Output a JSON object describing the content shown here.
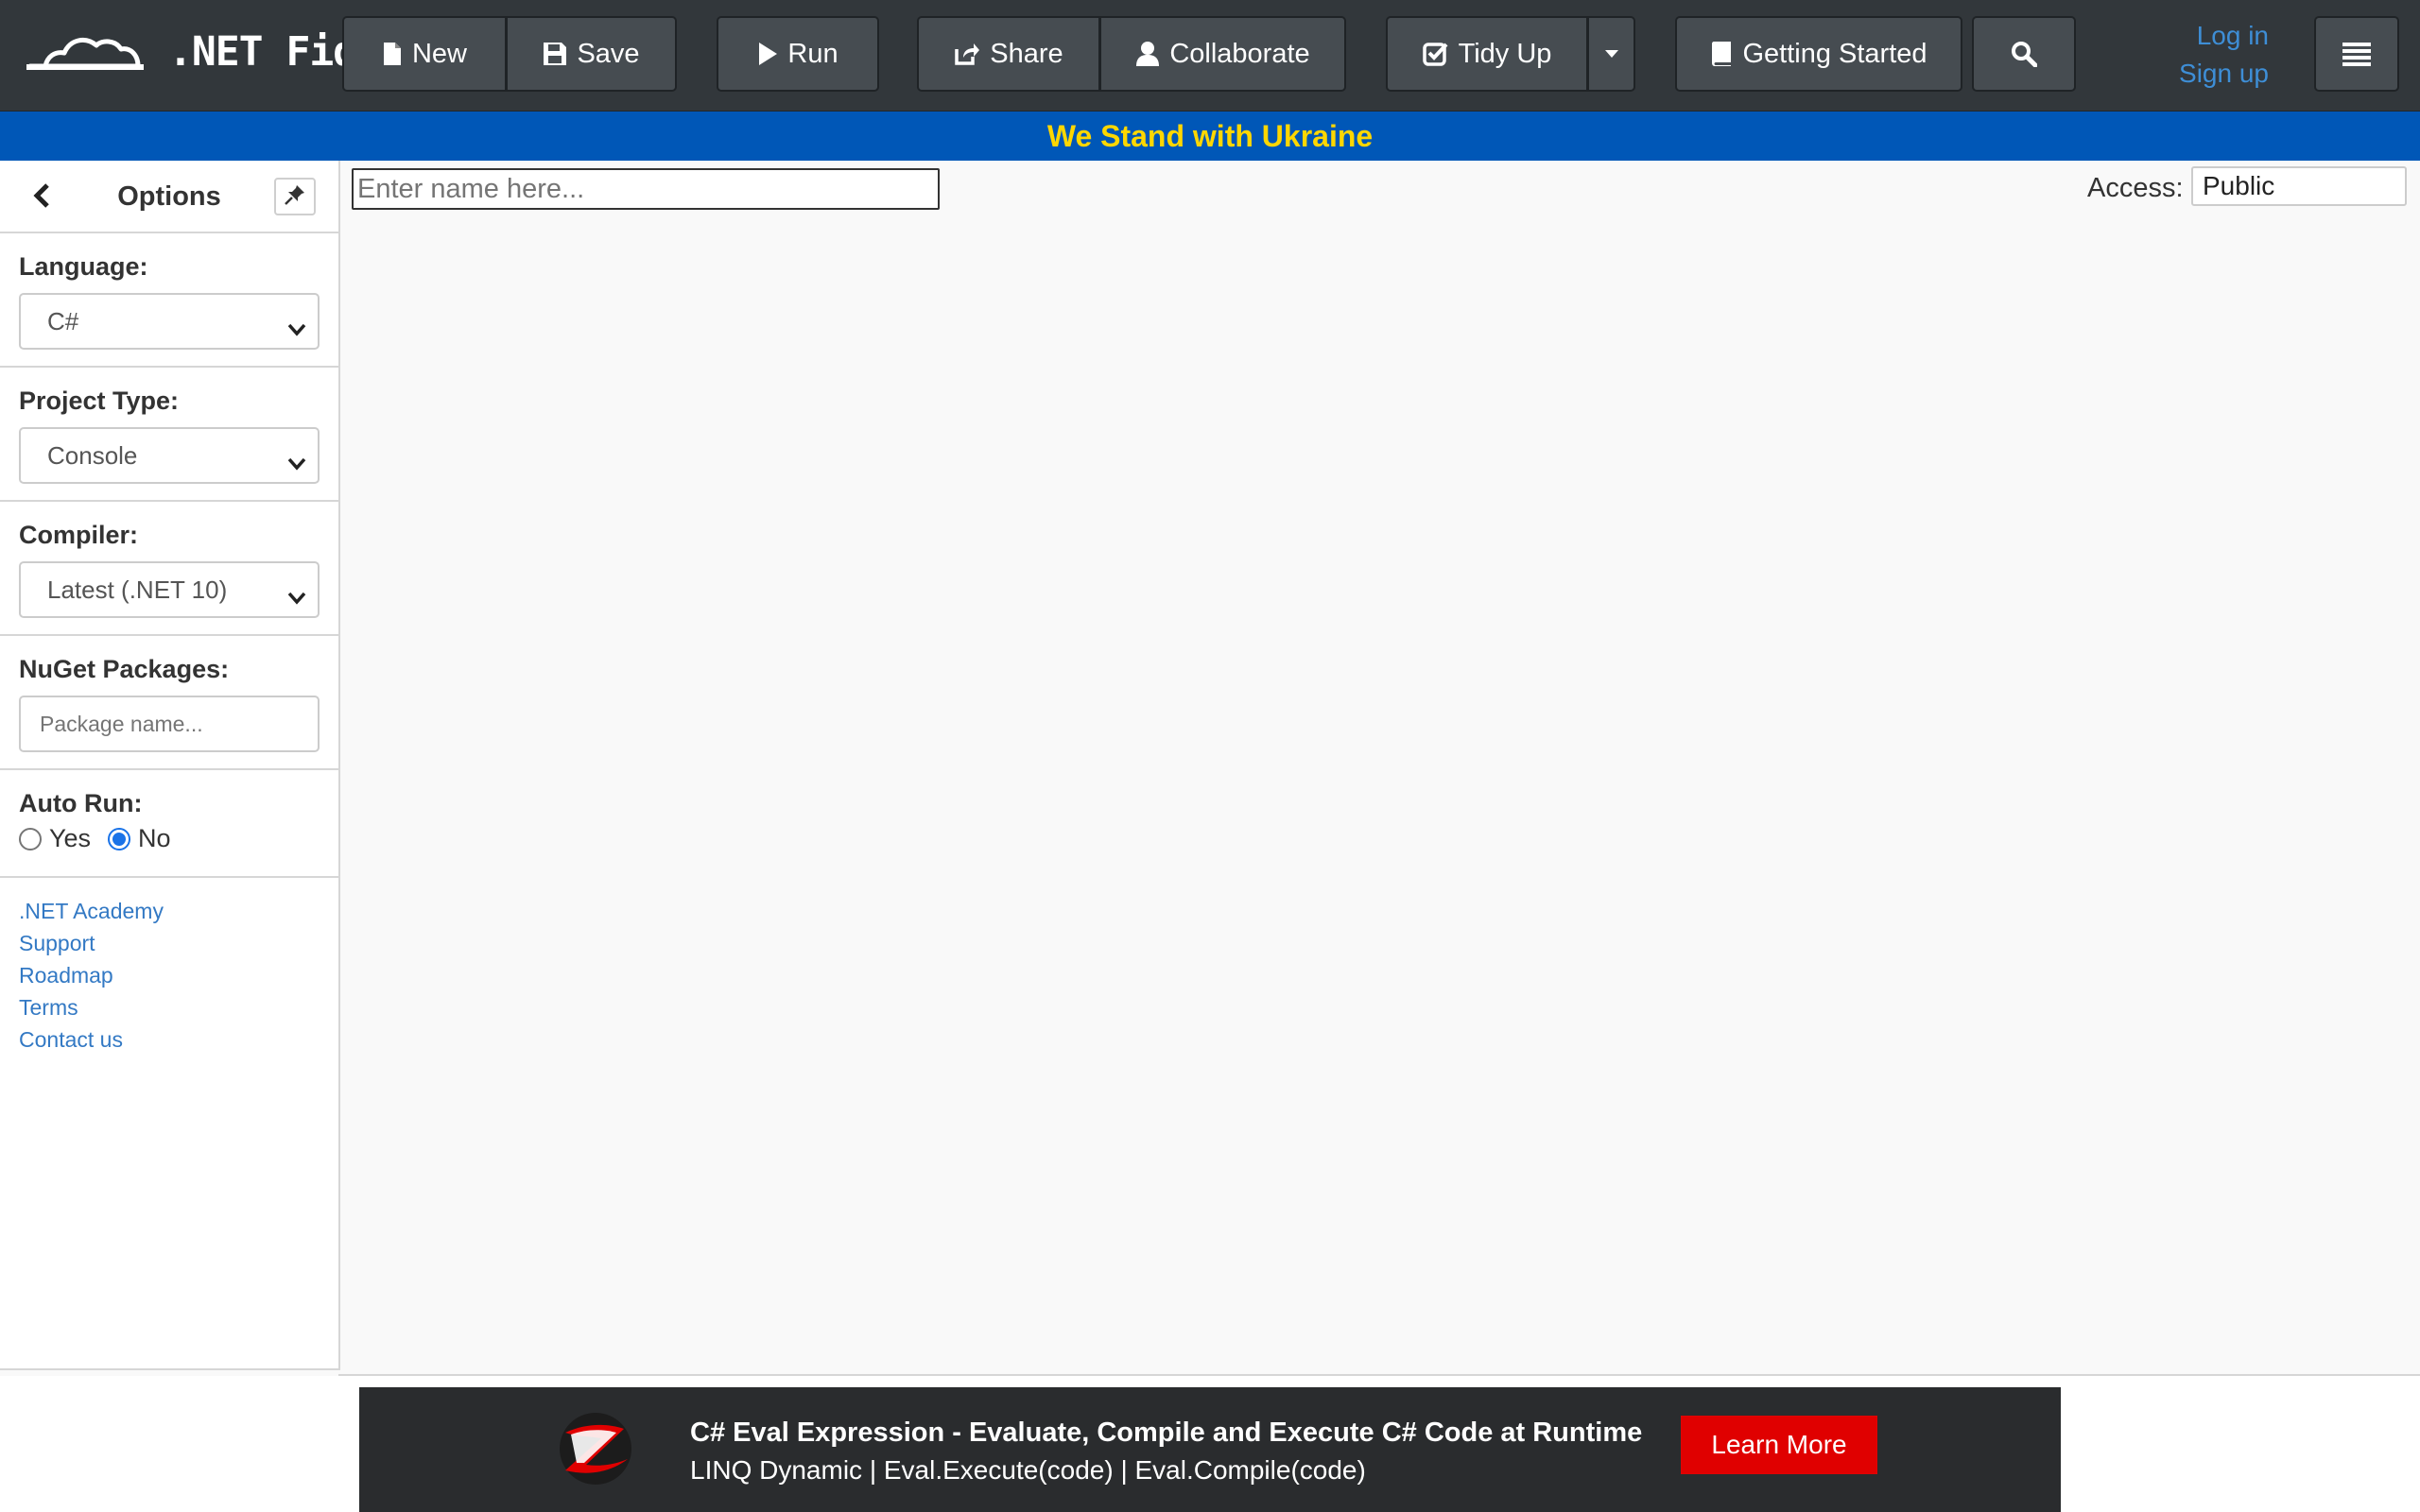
{
  "app": {
    "logo_text": ".NET Fiddle"
  },
  "toolbar": {
    "new_label": "New",
    "save_label": "Save",
    "run_label": "Run",
    "share_label": "Share",
    "collaborate_label": "Collaborate",
    "tidy_label": "Tidy Up",
    "getting_started_label": "Getting Started"
  },
  "auth": {
    "login": "Log in",
    "signup": "Sign up"
  },
  "banner": {
    "text": "We Stand with Ukraine"
  },
  "sidebar": {
    "title": "Options",
    "language": {
      "label": "Language:",
      "value": "C#"
    },
    "project_type": {
      "label": "Project Type:",
      "value": "Console"
    },
    "compiler": {
      "label": "Compiler:",
      "value": "Latest (.NET 10)"
    },
    "nuget": {
      "label": "NuGet Packages:",
      "placeholder": "Package name..."
    },
    "auto_run": {
      "label": "Auto Run:",
      "options": [
        "Yes",
        "No"
      ],
      "selected": "No"
    },
    "links": [
      ".NET Academy",
      "Support",
      "Roadmap",
      "Terms",
      "Contact us"
    ]
  },
  "main": {
    "name_placeholder": "Enter name here...",
    "access_label": "Access:",
    "access_value": "Public"
  },
  "ad": {
    "headline": "C# Eval Expression - Evaluate, Compile and Execute C# Code at Runtime",
    "subline": "LINQ Dynamic | Eval.Execute(code) | Eval.Compile(code)",
    "cta": "Learn More"
  },
  "colors": {
    "navbar": "#32373b",
    "button": "#464c51",
    "banner_bg": "#0057b7",
    "banner_text": "#ffd700",
    "link": "#3379c4",
    "cta": "#e00000"
  },
  "icons": [
    "cloud-logo-icon",
    "file-icon",
    "floppy-icon",
    "play-icon",
    "share-icon",
    "user-icon",
    "check-icon",
    "caret-down-icon",
    "book-icon",
    "search-icon",
    "hamburger-icon",
    "chevron-left-icon",
    "pin-icon",
    "z-logo-icon"
  ]
}
